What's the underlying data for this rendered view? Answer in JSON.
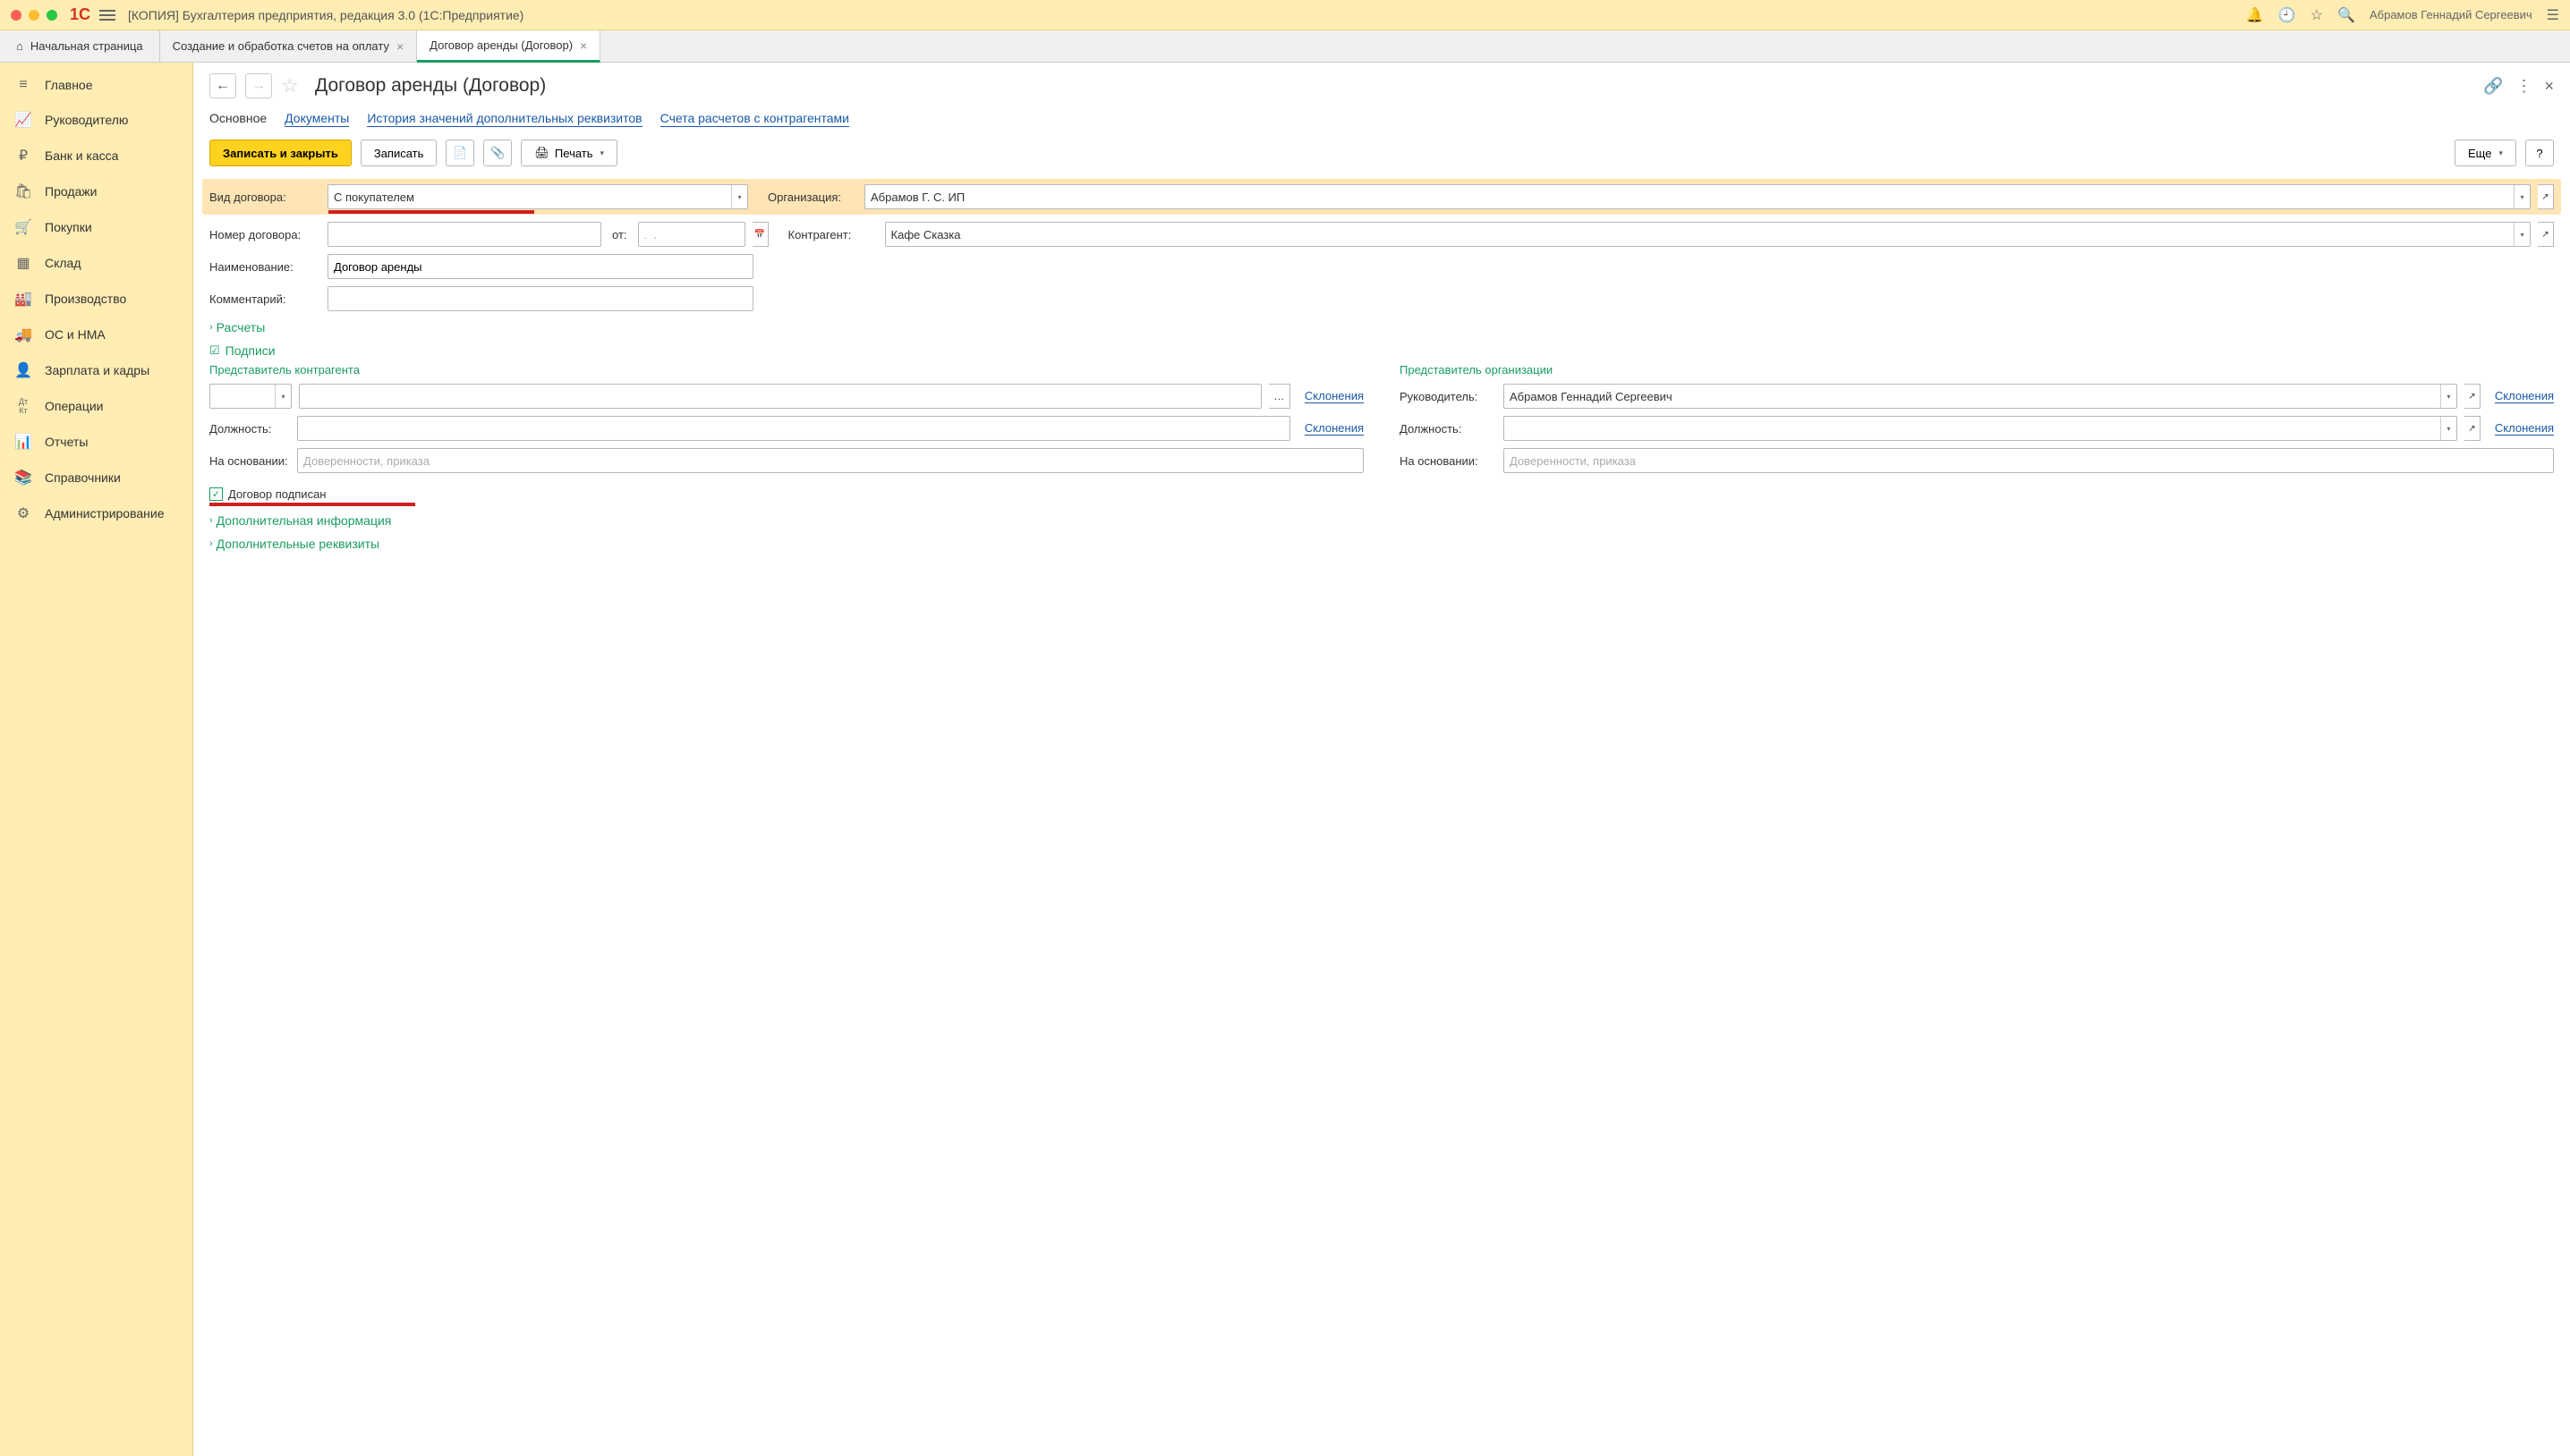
{
  "window": {
    "title": "[КОПИЯ] Бухгалтерия предприятия, редакция 3.0  (1С:Предприятие)",
    "user": "Абрамов Геннадий Сергеевич"
  },
  "tabs": {
    "home": "Начальная страница",
    "t1": "Создание и обработка счетов на оплату",
    "t2": "Договор аренды (Договор)"
  },
  "sidebar": {
    "items": [
      {
        "label": "Главное",
        "icon": "≡"
      },
      {
        "label": "Руководителю",
        "icon": "📈"
      },
      {
        "label": "Банк и касса",
        "icon": "₽"
      },
      {
        "label": "Продажи",
        "icon": "🛍"
      },
      {
        "label": "Покупки",
        "icon": "🛒"
      },
      {
        "label": "Склад",
        "icon": "▦"
      },
      {
        "label": "Производство",
        "icon": "🏭"
      },
      {
        "label": "ОС и НМА",
        "icon": "🚚"
      },
      {
        "label": "Зарплата и кадры",
        "icon": "👤"
      },
      {
        "label": "Операции",
        "icon": "Дт Кт"
      },
      {
        "label": "Отчеты",
        "icon": "📊"
      },
      {
        "label": "Справочники",
        "icon": "📚"
      },
      {
        "label": "Администрирование",
        "icon": "⚙"
      }
    ]
  },
  "page": {
    "title": "Договор аренды (Договор)",
    "subnav": {
      "main": "Основное",
      "docs": "Документы",
      "hist": "История значений дополнительных реквизитов",
      "acc": "Счета расчетов с контрагентами"
    },
    "toolbar": {
      "save_close": "Записать и закрыть",
      "save": "Записать",
      "print": "Печать",
      "more": "Еще"
    },
    "form": {
      "type_label": "Вид договора:",
      "type_value": "С покупателем",
      "org_label": "Организация:",
      "org_value": "Абрамов Г. С. ИП",
      "num_label": "Номер договора:",
      "from_label": "от:",
      "date_placeholder": ".  .",
      "contr_label": "Контрагент:",
      "contr_value": "Кафе Сказка",
      "name_label": "Наименование:",
      "name_value": "Договор аренды",
      "comment_label": "Комментарий:",
      "calc_section": "Расчеты",
      "sign_section": "Подписи",
      "rep_contr": "Представитель контрагента",
      "rep_org": "Представитель организации",
      "head_label": "Руководитель:",
      "head_value": "Абрамов Геннадий Сергеевич",
      "pos_label": "Должность:",
      "basis_label": "На основании:",
      "basis_placeholder": "Доверенности, приказа",
      "declension": "Склонения",
      "signed_label": "Договор подписан",
      "extra_info": "Дополнительная информация",
      "extra_req": "Дополнительные реквизиты"
    }
  }
}
